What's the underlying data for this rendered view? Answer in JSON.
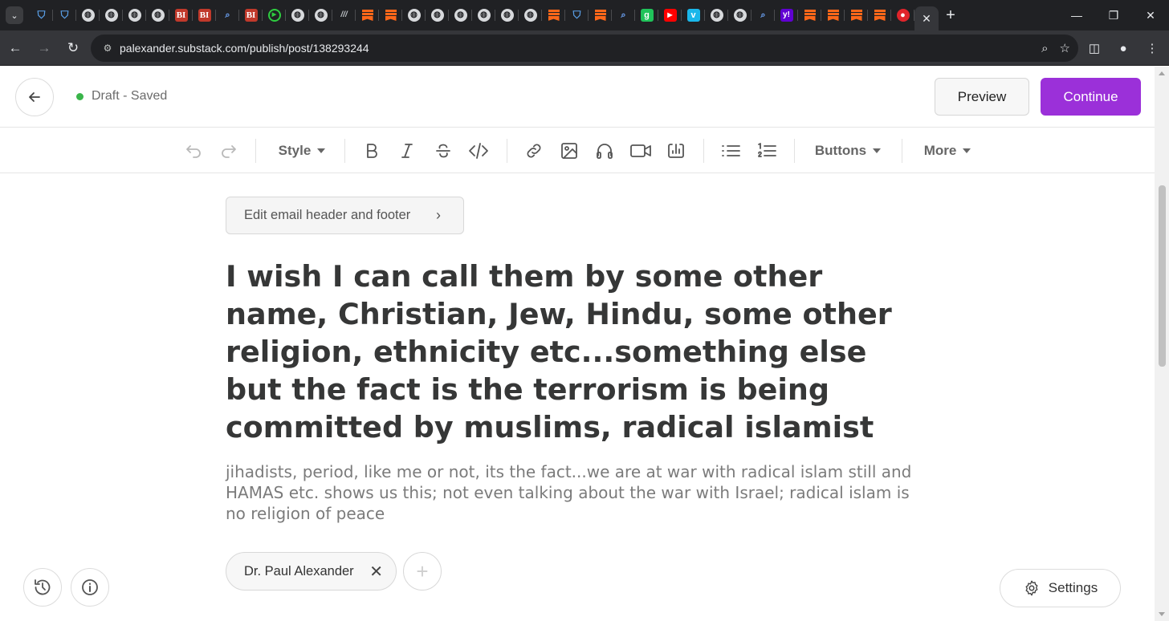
{
  "browser": {
    "url": "palexander.substack.com/publish/post/138293244",
    "favicons": [
      "shield",
      "shield",
      "globe",
      "globe",
      "globe",
      "globe",
      "bi",
      "bi",
      "magnifier",
      "bi",
      "play",
      "globe",
      "globe",
      "ww",
      "substack",
      "substack",
      "globe",
      "globe",
      "globe",
      "globe",
      "globe",
      "globe",
      "substack",
      "shield",
      "substack",
      "magnifier",
      "g",
      "youtube",
      "vimeo",
      "globe",
      "globe",
      "magnifier",
      "yahoo",
      "substack",
      "substack",
      "substack",
      "substack",
      "red-mic"
    ],
    "active_tab_close": "✕",
    "new_tab": "+"
  },
  "header": {
    "status": "Draft - Saved",
    "status_color": "#3ab54a",
    "preview_label": "Preview",
    "continue_label": "Continue",
    "accent": "#9b30d9"
  },
  "editor_toolbar": {
    "style_label": "Style",
    "buttons_label": "Buttons",
    "more_label": "More"
  },
  "post": {
    "email_header_footer_label": "Edit email header and footer",
    "title": "I wish I can call them by some other name, Christian, Jew, Hindu, some other religion, ethnicity etc...something else but the fact is the terrorism is being committed by muslims, radical islamist",
    "subtitle": "jihadists, period, like me or not, its the fact...we are at war with radical islam still and HAMAS etc. shows us this; not even talking about the war with Israel; radical islam is no religion of peace",
    "author": "Dr. Paul Alexander"
  },
  "footer": {
    "settings_label": "Settings"
  }
}
